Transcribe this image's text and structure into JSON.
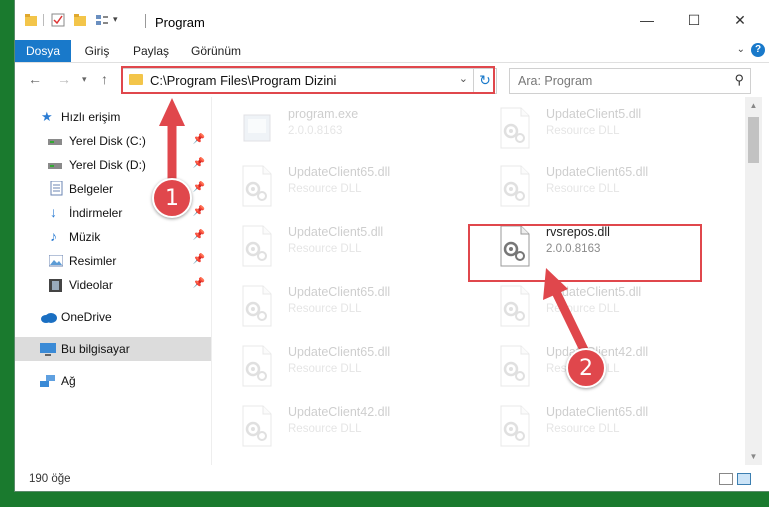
{
  "window": {
    "title": "Program",
    "minimize": "—",
    "maximize": "☐",
    "close": "✕"
  },
  "ribbon": {
    "tabs": [
      {
        "label": "Dosya",
        "active": true
      },
      {
        "label": "Giriş"
      },
      {
        "label": "Paylaş"
      },
      {
        "label": "Görünüm"
      }
    ],
    "help": "?"
  },
  "address": {
    "path": "C:\\Program Files\\Program Dizini",
    "search_placeholder": "Ara: Program"
  },
  "nav": {
    "items": [
      {
        "label": "Hızlı erişim",
        "icon": "star-icon",
        "color": "#2b7cd3"
      },
      {
        "label": "Yerel Disk (C:)",
        "icon": "drive-icon",
        "pinned": true
      },
      {
        "label": "Yerel Disk (D:)",
        "icon": "drive-icon",
        "pinned": true
      },
      {
        "label": "Belgeler",
        "icon": "documents-icon",
        "pinned": true
      },
      {
        "label": "İndirmeler",
        "icon": "download-icon",
        "pinned": true
      },
      {
        "label": "Müzik",
        "icon": "music-icon",
        "pinned": true
      },
      {
        "label": "Resimler",
        "icon": "pictures-icon",
        "pinned": true
      },
      {
        "label": "Videolar",
        "icon": "videos-icon",
        "pinned": true
      },
      {
        "label": "OneDrive",
        "icon": "cloud-icon"
      },
      {
        "label": "Bu bilgisayar",
        "icon": "computer-icon",
        "selected": true
      },
      {
        "label": "Ağ",
        "icon": "network-icon"
      }
    ]
  },
  "files": [
    {
      "name": "program.exe",
      "desc": "2.0.0.8163",
      "col": 0,
      "row": 0,
      "faded": true,
      "type": "exe"
    },
    {
      "name": "UpdateClient5.dll",
      "desc": "Resource DLL",
      "col": 1,
      "row": 0,
      "faded": true
    },
    {
      "name": "UpdateClient65.dll",
      "desc": "Resource DLL",
      "col": 0,
      "row": 1,
      "faded": true
    },
    {
      "name": "UpdateClient65.dll",
      "desc": "Resource DLL",
      "col": 1,
      "row": 1,
      "faded": true
    },
    {
      "name": "UpdateClient5.dll",
      "desc": "Resource DLL",
      "col": 0,
      "row": 2,
      "faded": true
    },
    {
      "name": "rvsrepos.dll",
      "desc": "2.0.0.8163",
      "col": 1,
      "row": 2,
      "faded": false
    },
    {
      "name": "UpdateClient65.dll",
      "desc": "Resource DLL",
      "col": 0,
      "row": 3,
      "faded": true
    },
    {
      "name": "UpdateClient5.dll",
      "desc": "Resource DLL",
      "col": 1,
      "row": 3,
      "faded": true
    },
    {
      "name": "UpdateClient65.dll",
      "desc": "Resource DLL",
      "col": 0,
      "row": 4,
      "faded": true
    },
    {
      "name": "UpdateClient42.dll",
      "desc": "Resource DLL",
      "col": 1,
      "row": 4,
      "faded": true
    },
    {
      "name": "UpdateClient42.dll",
      "desc": "Resource DLL",
      "col": 0,
      "row": 5,
      "faded": true
    },
    {
      "name": "UpdateClient65.dll",
      "desc": "Resource DLL",
      "col": 1,
      "row": 5,
      "faded": true
    }
  ],
  "status": {
    "count": "190 öğe"
  },
  "annotations": {
    "step1": "1",
    "step2": "2",
    "color": "#e0474c"
  }
}
